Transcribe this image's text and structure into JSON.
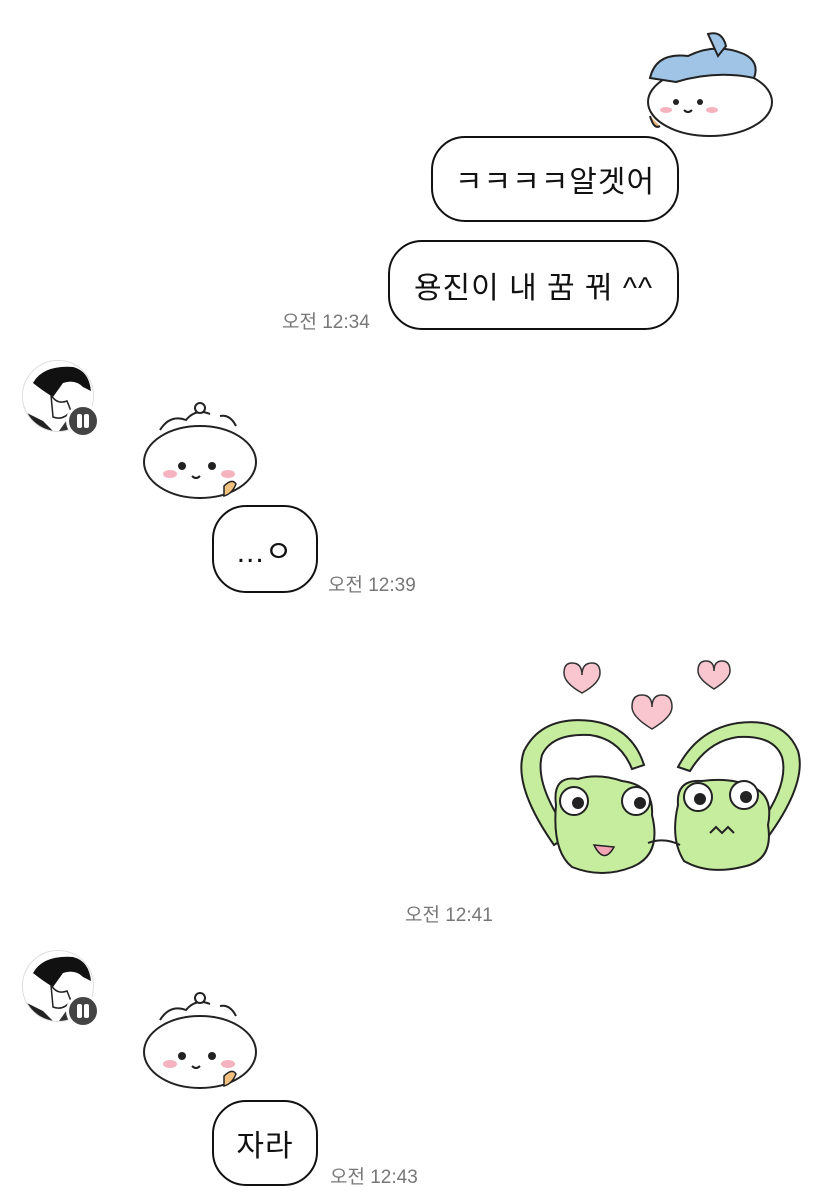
{
  "messages": [
    {
      "side": "me",
      "kind": "sticker",
      "sticker": "blue-hat-cat-sticker"
    },
    {
      "side": "me",
      "kind": "text",
      "text": "ㅋㅋㅋㅋ알겟어"
    },
    {
      "side": "me",
      "kind": "text",
      "text": "용진이 내 꿈 꿔 ^^",
      "time": "오전 12:34"
    },
    {
      "side": "them",
      "kind": "sticker",
      "sticker": "white-bear-sticker"
    },
    {
      "side": "them",
      "kind": "text",
      "text": "...ㅇ",
      "time": "오전 12:39"
    },
    {
      "side": "me",
      "kind": "sticker",
      "sticker": "green-frogs-hearts-sticker",
      "time": "오전 12:41"
    },
    {
      "side": "them",
      "kind": "sticker",
      "sticker": "white-bear-sticker"
    },
    {
      "side": "them",
      "kind": "text",
      "text": "자라",
      "time": "오전 12:43"
    }
  ],
  "contact": {
    "avatar": "manga-portrait-avatar",
    "badge_icon": "pause-badge-icon"
  },
  "colors": {
    "bubble_border": "#111111",
    "timestamp": "#777777",
    "heart": "#f9c6cf",
    "frog": "#c6ec9e",
    "cat_hat": "#9fc4e6"
  }
}
